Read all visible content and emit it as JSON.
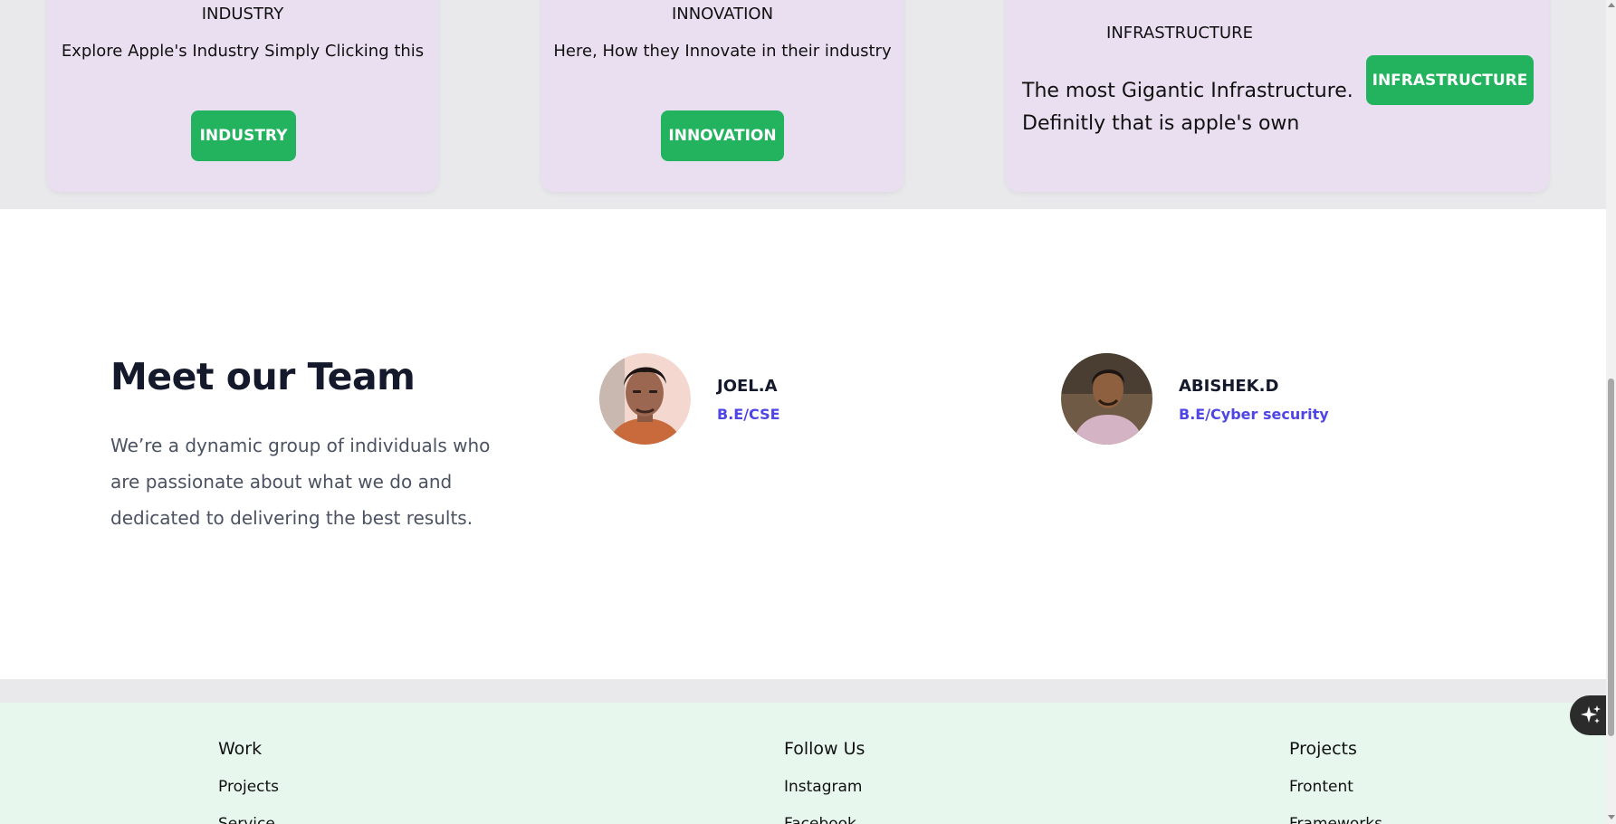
{
  "cards": [
    {
      "title": "INDUSTRY",
      "description": "Explore Apple's Industry Simply Clicking this",
      "button_label": "INDUSTRY"
    },
    {
      "title": "INNOVATION",
      "description": "Here, How they Innovate in their industry",
      "button_label": "INNOVATION"
    },
    {
      "title": "INFRASTRUCTURE",
      "description_lines": [
        "The most Gigantic Infrastructure.",
        "Definitly that is apple's own"
      ],
      "button_label": "INFRASTRUCTURE"
    }
  ],
  "team": {
    "title": "Meet our Team",
    "description": "We’re a dynamic group of individuals who are passionate about what we do and dedicated to delivering the best results.",
    "members": [
      {
        "name": "JOEL.A",
        "role": "B.E/CSE",
        "avatar_icon": "person-photo"
      },
      {
        "name": "ABISHEK.D",
        "role": "B.E/Cyber security",
        "avatar_icon": "person-photo"
      }
    ]
  },
  "footer": {
    "columns": [
      {
        "heading": "Work",
        "links": [
          "Projects",
          "Service"
        ]
      },
      {
        "heading": "Follow Us",
        "links": [
          "Instagram",
          "Facebook"
        ]
      },
      {
        "heading": "Projects",
        "links": [
          "Frontent",
          "Frameworks"
        ]
      }
    ]
  },
  "floating_button": {
    "icon": "sparkle-icon"
  },
  "colors": {
    "card_bg": "#eadff0",
    "button_green": "#23b35e",
    "role_indigo": "#4f46e5",
    "footer_bg": "#e7f7ee",
    "band_gray": "#e9e9ec"
  }
}
